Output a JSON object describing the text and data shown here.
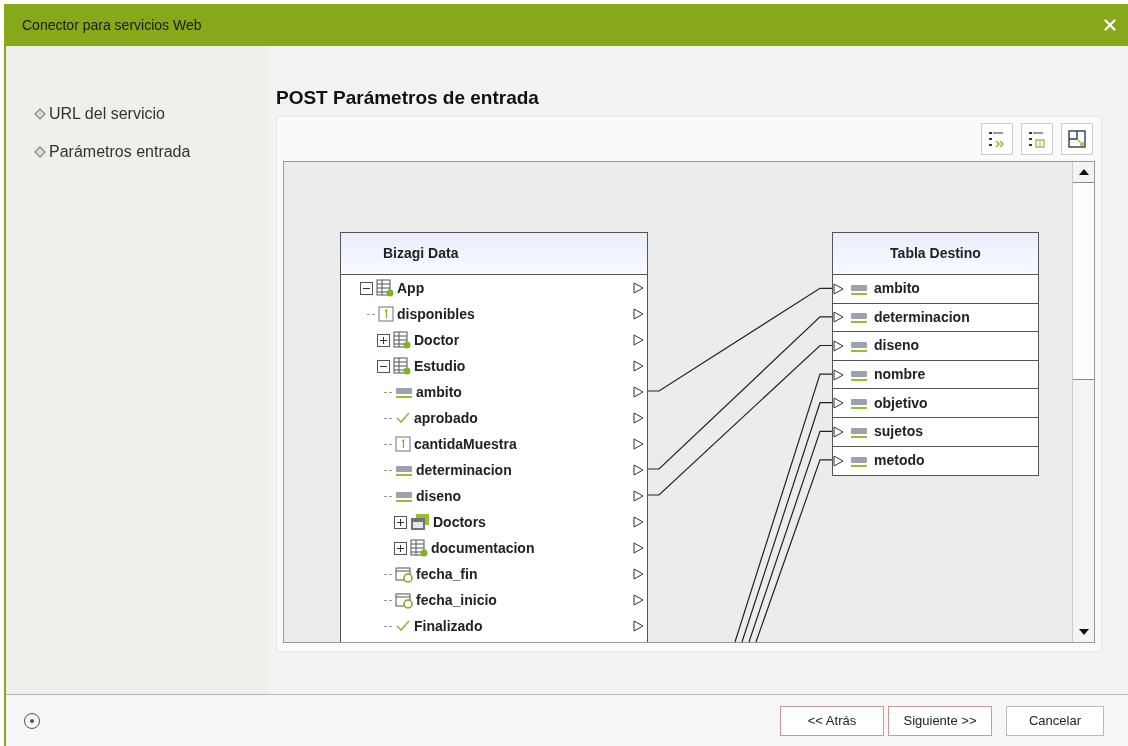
{
  "window": {
    "title": "Conector para servicios Web"
  },
  "sidebar": {
    "items": [
      {
        "label": "URL del servicio"
      },
      {
        "label": "Parámetros entrada"
      }
    ]
  },
  "page_title": "POST Parámetros de entrada",
  "source_table": {
    "title": "Bizagi Data",
    "items": [
      {
        "label": "App",
        "kind": "entity",
        "expanded": true,
        "children": [
          {
            "label": "disponibles",
            "kind": "number"
          },
          {
            "label": "Doctor",
            "kind": "entity",
            "expanded": false
          },
          {
            "label": "Estudio",
            "kind": "entity",
            "expanded": true,
            "children": [
              {
                "label": "ambito",
                "kind": "text",
                "linked": true
              },
              {
                "label": "aprobado",
                "kind": "boolean"
              },
              {
                "label": "cantidaMuestra",
                "kind": "number"
              },
              {
                "label": "determinacion",
                "kind": "text",
                "linked": true
              },
              {
                "label": "diseno",
                "kind": "text",
                "linked": true
              },
              {
                "label": "Doctors",
                "kind": "collection",
                "expanded": false
              },
              {
                "label": "documentacion",
                "kind": "entity",
                "expanded": false
              },
              {
                "label": "fecha_fin",
                "kind": "date"
              },
              {
                "label": "fecha_inicio",
                "kind": "date"
              },
              {
                "label": "Finalizado",
                "kind": "boolean"
              }
            ]
          }
        ]
      }
    ]
  },
  "target_table": {
    "title": "Tabla Destino",
    "fields": [
      {
        "label": "ambito",
        "linked": true
      },
      {
        "label": "determinacion",
        "linked": true
      },
      {
        "label": "diseno",
        "linked": true
      },
      {
        "label": "nombre",
        "linked": true
      },
      {
        "label": "objetivo",
        "linked": true
      },
      {
        "label": "sujetos",
        "linked": true
      },
      {
        "label": "metodo",
        "linked": true
      }
    ]
  },
  "buttons": [
    {
      "label": "<< Atrás",
      "kind": "nav"
    },
    {
      "label": "Siguiente >>",
      "kind": "nav"
    },
    {
      "label": "Cancelar",
      "kind": "plain"
    }
  ]
}
